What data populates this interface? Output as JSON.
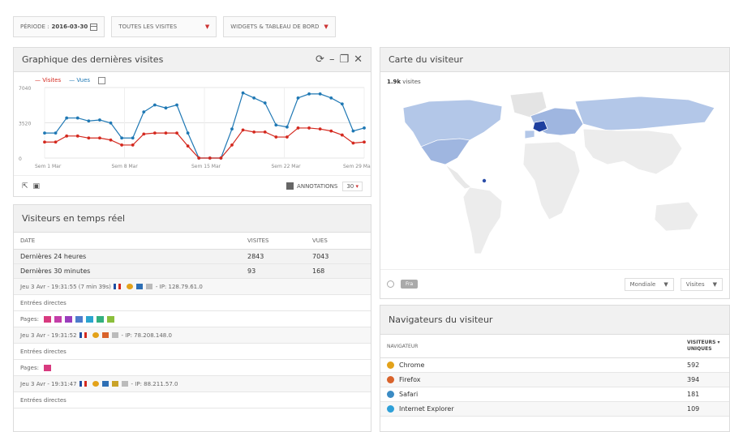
{
  "toolbar": {
    "period_label": "PÉRIODE :",
    "period_value": "2016-03-30",
    "segment": "TOUTES LES VISITES",
    "dashboard": "WIDGETS & TABLEAU DE BORD"
  },
  "evolution": {
    "title": "Graphique des dernières visites",
    "legend_visits": "Visites",
    "legend_pages": "Vues",
    "annotations_label": "ANNOTATIONS",
    "limit_value": "30",
    "colors": {
      "visits": "#d4291f",
      "pages": "#1f78b4"
    }
  },
  "chart_data": {
    "type": "line",
    "x_ticks": [
      "Sem 1 Mar",
      "Sem 8 Mar",
      "Sem 15 Mar",
      "Sem 22 Mar",
      "Sem 29 Mar"
    ],
    "y_ticks": [
      "7040",
      "3520",
      "0"
    ],
    "ylim": [
      0,
      7040
    ],
    "series": [
      {
        "name": "Visites",
        "color": "#d4291f",
        "values": [
          1600,
          1600,
          2200,
          2200,
          2000,
          2000,
          1800,
          1300,
          1300,
          2400,
          2500,
          2500,
          2500,
          1200,
          0,
          0,
          0,
          1300,
          2800,
          2600,
          2600,
          2100,
          2100,
          3000,
          3000,
          2900,
          2700,
          2300,
          1500,
          1600
        ]
      },
      {
        "name": "Vues",
        "color": "#1f78b4",
        "values": [
          2500,
          2500,
          4000,
          4000,
          3700,
          3800,
          3500,
          2000,
          2000,
          4600,
          5300,
          5000,
          5300,
          2500,
          0,
          0,
          0,
          2900,
          6500,
          6000,
          5500,
          3300,
          3100,
          6000,
          6400,
          6400,
          6000,
          5400,
          2700,
          3000
        ]
      }
    ]
  },
  "realtime": {
    "title": "Visiteurs en temps réel",
    "headers": [
      "DATE",
      "VISITES",
      "VUES"
    ],
    "rows": [
      {
        "label": "Dernières 24 heures",
        "visits": "2843",
        "views": "7043"
      },
      {
        "label": "Dernières 30 minutes",
        "visits": "93",
        "views": "168"
      }
    ],
    "visits": [
      {
        "time": "Jeu 3 Avr - 19:31:55 (7 min 39s)",
        "ip": "- IP: 128.79.61.0",
        "referrer": "Entrées directes",
        "pages_label": "Pages:"
      },
      {
        "time": "Jeu 3 Avr - 19:31:52",
        "ip": "- IP: 78.208.148.0",
        "referrer": "Entrées directes",
        "pages_label": "Pages:"
      },
      {
        "time": "Jeu 3 Avr - 19:31:47",
        "ip": "- IP: 88.211.57.0",
        "referrer": "Entrées directes"
      }
    ]
  },
  "map": {
    "title": "Carte du visiteur",
    "count_value": "1.9k",
    "count_label": "visites",
    "world_button": "Fra",
    "select_level": "Mondiale",
    "select_metric": "Visites"
  },
  "browsers": {
    "title": "Navigateurs du visiteur",
    "col_name": "NAVIGATEUR",
    "col_value_1": "VISITEURS",
    "col_value_2": "UNIQUES",
    "rows": [
      {
        "name": "Chrome",
        "value": "592",
        "color": "#e3a21a"
      },
      {
        "name": "Firefox",
        "value": "394",
        "color": "#d9632b"
      },
      {
        "name": "Safari",
        "value": "181",
        "color": "#3b8bc4"
      },
      {
        "name": "Internet Explorer",
        "value": "109",
        "color": "#2ea0d8"
      }
    ]
  }
}
